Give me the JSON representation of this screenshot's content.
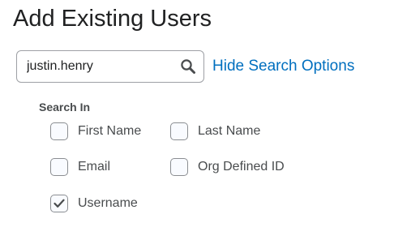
{
  "page": {
    "title": "Add Existing Users"
  },
  "search": {
    "value": "justin.henry",
    "icon": "search-icon",
    "hide_options_label": "Hide Search Options"
  },
  "search_in": {
    "label": "Search In",
    "options": [
      {
        "label": "First Name",
        "checked": false
      },
      {
        "label": "Last Name",
        "checked": false
      },
      {
        "label": "Email",
        "checked": false
      },
      {
        "label": "Org Defined ID",
        "checked": false
      },
      {
        "label": "Username",
        "checked": true
      }
    ]
  },
  "colors": {
    "link": "#006fbf",
    "text": "#202122",
    "muted_text": "#494c4e",
    "border": "#9ea0a5"
  }
}
